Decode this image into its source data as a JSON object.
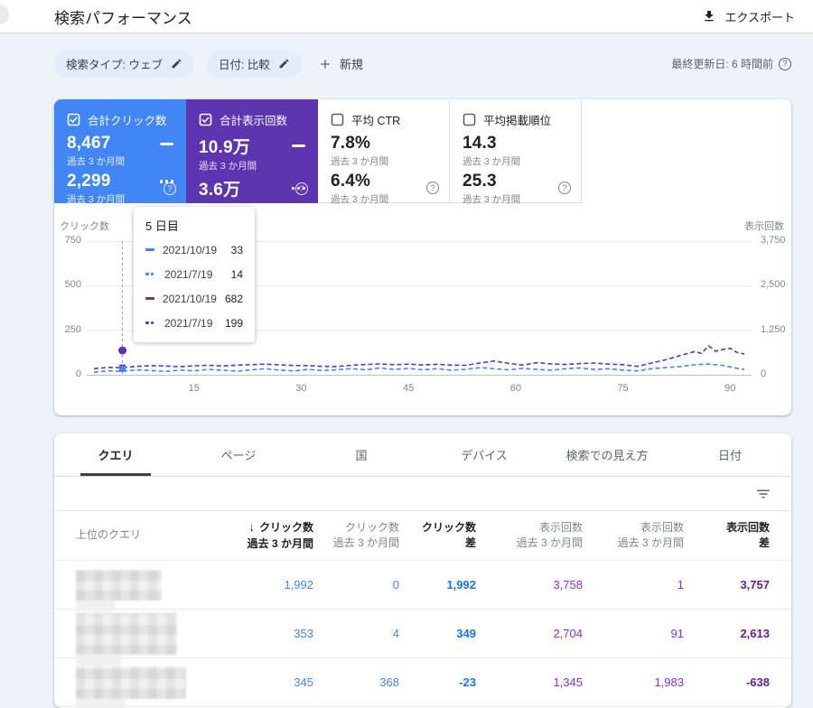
{
  "header": {
    "title": "検索パフォーマンス",
    "export_label": "エクスポート"
  },
  "filters": {
    "chips": [
      {
        "label": "検索タイプ: ウェブ"
      },
      {
        "label": "日付: 比較"
      }
    ],
    "new_label": "新規",
    "last_updated": "最終更新日: 6 時間前"
  },
  "metric_cards": [
    {
      "label": "合計クリック数",
      "checked": true,
      "color": "#4285f4",
      "value_current": "8,467",
      "value_previous": "2,299",
      "period": "過去 3 か月間"
    },
    {
      "label": "合計表示回数",
      "checked": true,
      "color": "#5e35b1",
      "value_current": "10.9万",
      "value_previous": "3.6万",
      "period": "過去 3 か月間"
    },
    {
      "label": "平均 CTR",
      "checked": false,
      "value_current": "7.8%",
      "value_previous": "6.4%",
      "period": "過去 3 か月間"
    },
    {
      "label": "平均掲載順位",
      "checked": false,
      "value_current": "14.3",
      "value_previous": "25.3",
      "period": "過去 3 か月間"
    }
  ],
  "chart_data": {
    "type": "line",
    "left_axis": {
      "label": "クリック数",
      "ticks": [
        "750",
        "500",
        "250",
        "0"
      ],
      "max": 750
    },
    "right_axis": {
      "label": "表示回数",
      "ticks": [
        "3,750",
        "2,500",
        "1,250",
        "0"
      ],
      "max": 3750
    },
    "x_ticks": [
      15,
      30,
      45,
      60,
      75,
      90
    ],
    "x_max": 93,
    "series": [
      {
        "name": "表示回数 2021/7/19",
        "color": "#5e35b1",
        "axis": "right",
        "points": [
          [
            1,
            170
          ],
          [
            3,
            205
          ],
          [
            5,
            199
          ],
          [
            7,
            235
          ],
          [
            9,
            255
          ],
          [
            11,
            245
          ],
          [
            13,
            225
          ],
          [
            15,
            250
          ],
          [
            17,
            265
          ],
          [
            19,
            245
          ],
          [
            21,
            270
          ],
          [
            23,
            285
          ],
          [
            25,
            300
          ],
          [
            27,
            275
          ],
          [
            29,
            260
          ],
          [
            31,
            255
          ],
          [
            33,
            235
          ],
          [
            35,
            230
          ],
          [
            37,
            265
          ],
          [
            39,
            290
          ],
          [
            41,
            305
          ],
          [
            43,
            285
          ],
          [
            45,
            300
          ],
          [
            47,
            275
          ],
          [
            49,
            295
          ],
          [
            51,
            270
          ],
          [
            53,
            265
          ],
          [
            55,
            330
          ],
          [
            57,
            385
          ],
          [
            59,
            320
          ],
          [
            61,
            270
          ],
          [
            63,
            340
          ],
          [
            65,
            305
          ],
          [
            67,
            290
          ],
          [
            69,
            315
          ],
          [
            71,
            330
          ],
          [
            73,
            300
          ],
          [
            75,
            285
          ],
          [
            77,
            235
          ],
          [
            79,
            330
          ],
          [
            81,
            420
          ],
          [
            83,
            540
          ],
          [
            85,
            650
          ],
          [
            86,
            600
          ],
          [
            87,
            810
          ],
          [
            88,
            660
          ],
          [
            89,
            710
          ],
          [
            90,
            745
          ],
          [
            91,
            620
          ],
          [
            92,
            585
          ]
        ]
      },
      {
        "name": "クリック数 2021/7/19",
        "color": "#4285f4",
        "axis": "left",
        "points": [
          [
            1,
            14
          ],
          [
            3,
            22
          ],
          [
            5,
            20
          ],
          [
            7,
            28
          ],
          [
            9,
            24
          ],
          [
            11,
            18
          ],
          [
            13,
            26
          ],
          [
            15,
            22
          ],
          [
            17,
            30
          ],
          [
            19,
            26
          ],
          [
            21,
            20
          ],
          [
            23,
            28
          ],
          [
            25,
            34
          ],
          [
            27,
            26
          ],
          [
            29,
            22
          ],
          [
            31,
            30
          ],
          [
            33,
            24
          ],
          [
            35,
            28
          ],
          [
            37,
            34
          ],
          [
            39,
            28
          ],
          [
            41,
            38
          ],
          [
            43,
            30
          ],
          [
            45,
            36
          ],
          [
            47,
            28
          ],
          [
            49,
            34
          ],
          [
            51,
            26
          ],
          [
            53,
            30
          ],
          [
            55,
            40
          ],
          [
            57,
            34
          ],
          [
            59,
            28
          ],
          [
            61,
            36
          ],
          [
            63,
            30
          ],
          [
            65,
            26
          ],
          [
            67,
            34
          ],
          [
            69,
            38
          ],
          [
            71,
            30
          ],
          [
            73,
            34
          ],
          [
            75,
            26
          ],
          [
            77,
            22
          ],
          [
            79,
            34
          ],
          [
            81,
            40
          ],
          [
            83,
            46
          ],
          [
            85,
            56
          ],
          [
            87,
            60
          ],
          [
            89,
            52
          ],
          [
            91,
            36
          ],
          [
            92,
            30
          ]
        ]
      }
    ],
    "hover": {
      "day": 5,
      "markers": [
        {
          "shape": "circle",
          "color": "#5e35b1",
          "axis": "right",
          "value": 682
        },
        {
          "shape": "square",
          "color": "#5e35b1",
          "axis": "right",
          "value": 199
        },
        {
          "shape": "square",
          "color": "#4285f4",
          "axis": "left",
          "value": 33
        }
      ]
    },
    "tooltip": {
      "title": "5 日目",
      "rows": [
        {
          "marker": "solid-blue",
          "date": "2021/10/19",
          "value": "33"
        },
        {
          "marker": "dotted-blue",
          "date": "2021/7/19",
          "value": "14"
        },
        {
          "marker": "solid-purple",
          "date": "2021/10/19",
          "value": "682"
        },
        {
          "marker": "dotted-purple",
          "date": "2021/7/19",
          "value": "199"
        }
      ]
    }
  },
  "table": {
    "tabs": [
      {
        "label": "クエリ",
        "active": true
      },
      {
        "label": "ページ",
        "active": false
      },
      {
        "label": "国",
        "active": false
      },
      {
        "label": "デバイス",
        "active": false
      },
      {
        "label": "検索での見え方",
        "active": false
      },
      {
        "label": "日付",
        "active": false
      }
    ],
    "first_col_header": "上位のクエリ",
    "columns": [
      {
        "line1": "クリック数",
        "line2": "過去 3 か月間",
        "sorted": true,
        "style": "bold",
        "num_color": "c-blue"
      },
      {
        "line1": "クリック数",
        "line2": "過去 3 か月間",
        "sorted": false,
        "style": "gray",
        "num_color": "c-blue"
      },
      {
        "line1": "クリック数",
        "line2": "差",
        "sorted": false,
        "style": "bold",
        "num_color": "c-blue-bold"
      },
      {
        "line1": "表示回数",
        "line2": "過去 3 か月間",
        "sorted": false,
        "style": "gray",
        "num_color": "c-purple"
      },
      {
        "line1": "表示回数",
        "line2": "過去 3 か月間",
        "sorted": false,
        "style": "gray",
        "num_color": "c-purple"
      },
      {
        "line1": "表示回数",
        "line2": "差",
        "sorted": false,
        "style": "bold",
        "num_color": "c-purple-bold"
      }
    ],
    "rows": [
      {
        "query_redacted": true,
        "values": [
          "1,992",
          "0",
          "1,992",
          "3,758",
          "1",
          "3,757"
        ]
      },
      {
        "query_redacted": true,
        "values": [
          "353",
          "4",
          "349",
          "2,704",
          "91",
          "2,613"
        ]
      },
      {
        "query_redacted": true,
        "values": [
          "345",
          "368",
          "-23",
          "1,345",
          "1,983",
          "-638"
        ]
      }
    ]
  }
}
